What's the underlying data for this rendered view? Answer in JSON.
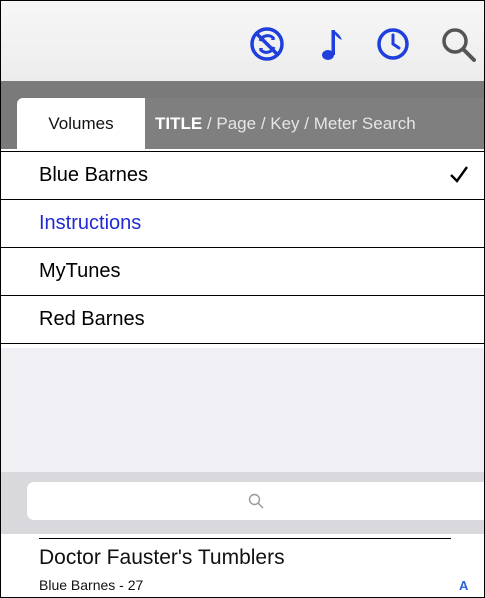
{
  "toolbar": {
    "icons": [
      "no-sync-icon",
      "music-note-icon",
      "clock-icon",
      "search-icon"
    ],
    "accent_color": "#1f3fdd"
  },
  "tabs": {
    "volumes_label": "Volumes",
    "search_label_bold": "TITLE",
    "search_label_rest": " / Page / Key / Meter Search"
  },
  "volumes": [
    {
      "label": "Blue Barnes",
      "checked": true
    },
    {
      "label": "Instructions",
      "link": true
    },
    {
      "label": "MyTunes"
    },
    {
      "label": "Red Barnes"
    }
  ],
  "search": {
    "value": "",
    "placeholder": ""
  },
  "results": [
    {
      "title": "Doctor Fauster's Tumblers",
      "subtitle": "Blue Barnes - 27",
      "index": "A"
    }
  ]
}
